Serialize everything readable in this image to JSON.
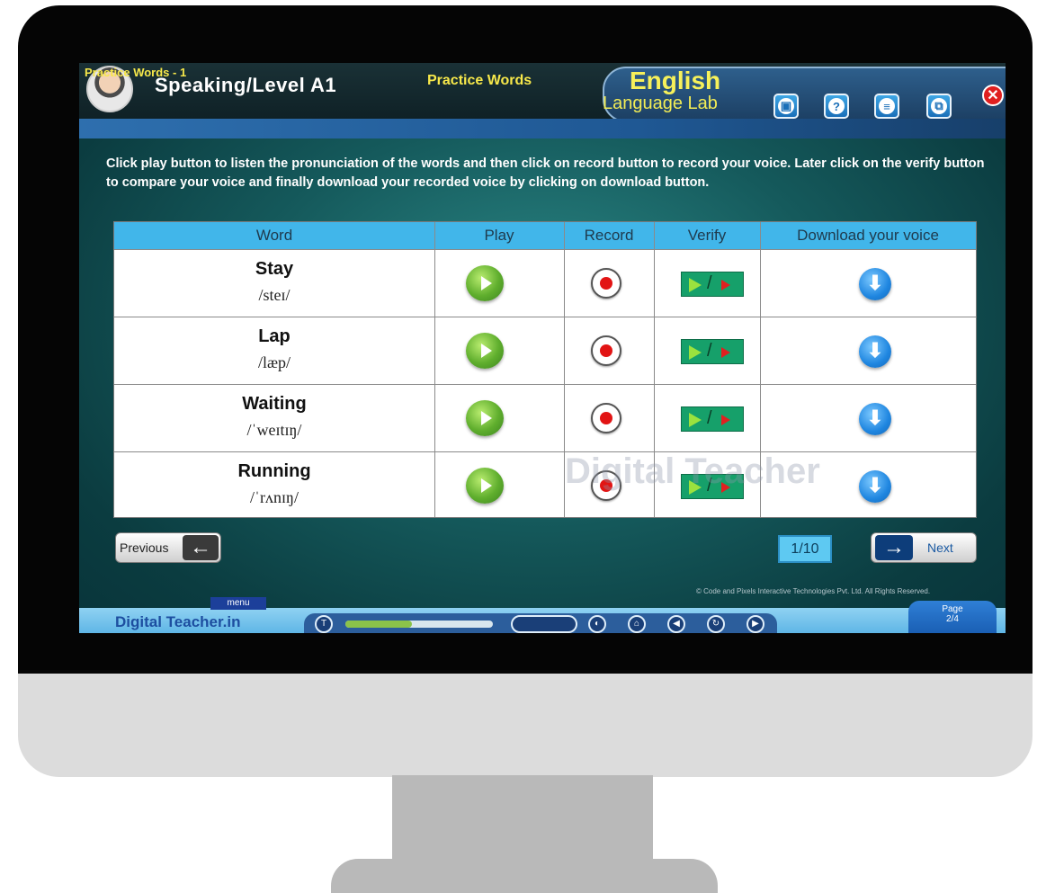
{
  "header": {
    "level_title": "Speaking/Level A1",
    "section_label": "Practice Words",
    "brand_main": "English",
    "brand_sub": "Language Lab"
  },
  "subheader": {
    "title": "Practice Words - 1"
  },
  "instructions": "Click play button to listen the pronunciation of the words and then click on record button to record your voice. Later click on the verify button to compare your voice and finally download your recorded voice by clicking on download button.",
  "table": {
    "columns": [
      "Word",
      "Play",
      "Record",
      "Verify",
      "Download your voice"
    ],
    "rows": [
      {
        "word": "Stay",
        "ipa": "/steɪ/"
      },
      {
        "word": "Lap",
        "ipa": "/læp/"
      },
      {
        "word": "Waiting",
        "ipa": "/ˈweɪtɪŋ/"
      },
      {
        "word": "Running",
        "ipa": "/ˈrʌnɪŋ/"
      }
    ]
  },
  "watermark": "Digital Teacher",
  "nav": {
    "previous_label": "Previous",
    "next_label": "Next",
    "page_indicator": "1/10"
  },
  "footer": {
    "copyright": "© Code and Pixels Interactive Technologies Pvt. Ltd. All Rights Reserved.",
    "logo": "Digital Teacher.in",
    "menu_label": "menu",
    "page_label": "Page",
    "page_value": "2/4",
    "audio_progress": 0.45
  },
  "icons": {
    "play": "play-circle-icon",
    "record": "record-icon",
    "verify": "verify-compare-icon",
    "download": "download-arrow-icon",
    "close": "close-icon"
  },
  "colors": {
    "table_header": "#41b6ea",
    "accent_yellow": "#f7e84a",
    "close_red": "#e02020"
  }
}
